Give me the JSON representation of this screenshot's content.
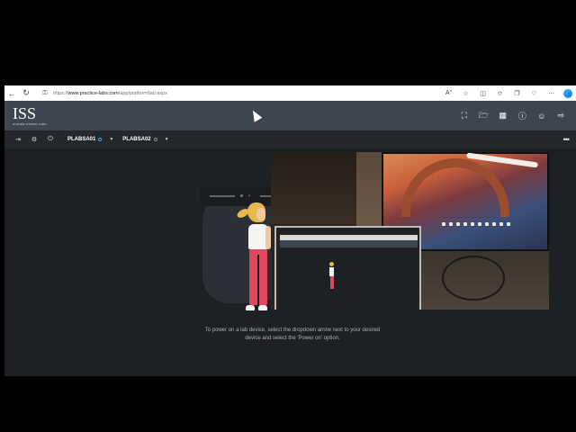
{
  "browser": {
    "url_prefix": "https://",
    "url_host": "www.practice-labs.com",
    "url_path": "/app/platform/lab.aspx",
    "icons": [
      "back-icon",
      "refresh-icon",
      "lock-icon",
      "read-aloud-icon",
      "favorite-star-icon",
      "split-screen-icon",
      "favorites-icon",
      "collections-icon",
      "browser-essentials-icon",
      "edge-copilot-icon"
    ]
  },
  "header": {
    "logo_text": "ISS",
    "logo_subtext": "GUIDED HYBRID LABS",
    "icons": [
      "fullscreen-icon",
      "folder-icon",
      "chart-icon",
      "help-icon",
      "user-icon",
      "logout-icon"
    ]
  },
  "toolbar": {
    "icons": [
      "exit-icon",
      "settings-icon",
      "power-icon"
    ],
    "devices": [
      {
        "name": "PLABSA01",
        "status_color": "#3da5e8"
      },
      {
        "name": "PLABSA02",
        "status_color": "#888888"
      }
    ],
    "more_icon": "more-horizontal-icon"
  },
  "main": {
    "instructions_line1": "To power on a lab device, select the dropdown arrow next to your desired",
    "instructions_line2": "device and select the 'Power on' option."
  },
  "colors": {
    "header_bg": "#3d4650",
    "toolbar_bg": "#24282c",
    "content_bg": "#1e2124",
    "accent_blue": "#3da5e8",
    "figure_pants": "#e0485e",
    "figure_hair": "#e8b84a"
  }
}
